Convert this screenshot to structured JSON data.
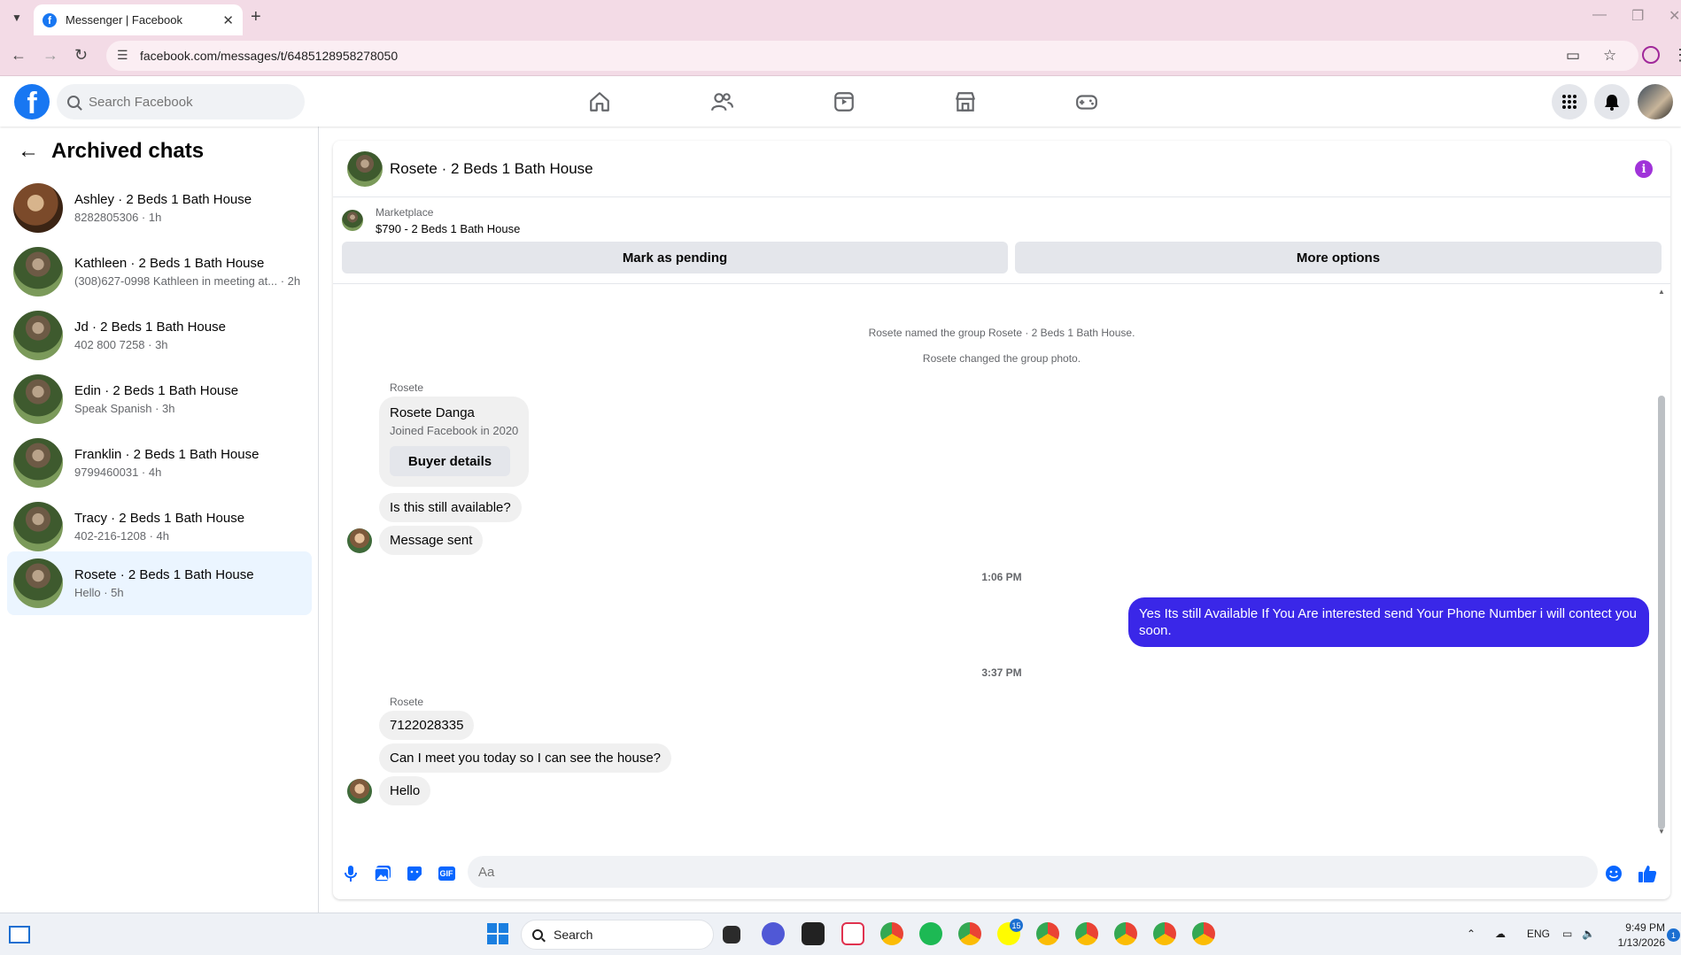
{
  "browser": {
    "tab_title": "Messenger | Facebook",
    "url": "facebook.com/messages/t/6485128958278050"
  },
  "fb": {
    "search_placeholder": "Search Facebook"
  },
  "left": {
    "title": "Archived chats",
    "chats": [
      {
        "name": "Ashley · 2 Beds 1 Bath House",
        "sub": "8282805306 · 1h"
      },
      {
        "name": "Kathleen · 2 Beds 1 Bath House",
        "sub": "(308)627-0998 Kathleen in meeting at... · 2h"
      },
      {
        "name": "Jd · 2 Beds 1 Bath House",
        "sub": "402 800 7258 · 3h"
      },
      {
        "name": "Edin · 2 Beds 1 Bath House",
        "sub": "Speak Spanish · 3h"
      },
      {
        "name": "Franklin · 2 Beds 1 Bath House",
        "sub": "9799460031 · 4h"
      },
      {
        "name": "Tracy · 2 Beds 1 Bath House",
        "sub": "402-216-1208 · 4h"
      },
      {
        "name": "Rosete · 2 Beds 1 Bath House",
        "sub": "Hello · 5h"
      }
    ]
  },
  "convo": {
    "title": "Rosete · 2 Beds 1 Bath House",
    "marketplace_label": "Marketplace",
    "listing": "$790 - 2 Beds 1 Bath House",
    "mark_pending": "Mark as pending",
    "more_options": "More options",
    "sys1": "Rosete named the group Rosete · 2 Beds 1 Bath House.",
    "sys2": "Rosete changed the group photo.",
    "sender": "Rosete",
    "card_name": "Rosete Danga",
    "card_sub": "Joined Facebook in 2020",
    "card_button": "Buyer details",
    "msg1": "Is this still available?",
    "msg2": "Message sent",
    "time1": "1:06 PM",
    "out1": "Yes Its still Available If You Are interested send Your Phone Number i will contect you soon.",
    "time2": "3:37 PM",
    "sender2": "Rosete",
    "msg3": "7122028335",
    "msg4": "Can I meet you today so I can see the house?",
    "msg5": "Hello",
    "composer_placeholder": "Aa",
    "gif_label": "GIF"
  },
  "taskbar": {
    "search": "Search",
    "lang": "ENG",
    "time": "9:49 PM",
    "date": "1/13/2026",
    "badge_count": "15",
    "notif_count": "1"
  },
  "colors": {
    "fb_blue": "#1877f2",
    "outgoing_bubble": "#3a27e8",
    "active_chat_bg": "#ebf5ff",
    "chrome_bg": "#f3dbe6"
  }
}
